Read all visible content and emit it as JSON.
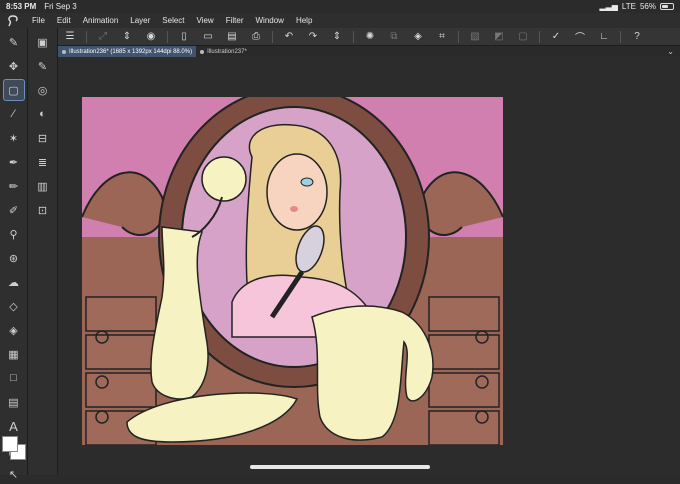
{
  "status_bar": {
    "time": "8:53 PM",
    "date": "Fri Sep 3",
    "network": "LTE",
    "battery": "56%",
    "battery_level": 0.56
  },
  "menu": {
    "items": [
      "File",
      "Edit",
      "Animation",
      "Layer",
      "Select",
      "View",
      "Filter",
      "Window",
      "Help"
    ]
  },
  "tabs": [
    {
      "label": "Illustration236* (1685 x 1392px 144dpi 88.0%)",
      "active": true
    },
    {
      "label": "Illustration237*",
      "active": false
    }
  ],
  "colors": {
    "accent": "#6d8fc0",
    "tab_active": "#41546e",
    "bg_pink": "#d17fae",
    "wood": "#9b6656",
    "mirror": "#d6a2c8",
    "cream": "#f6f2c2"
  },
  "icons": {
    "left_tools": [
      "pen-settings-icon",
      "move-icon",
      "marquee-icon",
      "eyedropper-icon",
      "magic-wand-icon",
      "pen-icon",
      "pencil-icon",
      "brush-icon",
      "airbrush-icon",
      "decoration-icon",
      "blend-icon",
      "eraser-icon",
      "fill-icon",
      "gradient-icon",
      "frame-icon",
      "balloon-icon",
      "text-icon",
      "ruler-icon",
      "object-icon"
    ],
    "sub_tools": [
      "layer-icon",
      "brush-size-icon",
      "color-wheel-icon",
      "layer-props-icon",
      "navigator-icon",
      "layers-stack-icon",
      "material-icon",
      "more-icon"
    ]
  }
}
